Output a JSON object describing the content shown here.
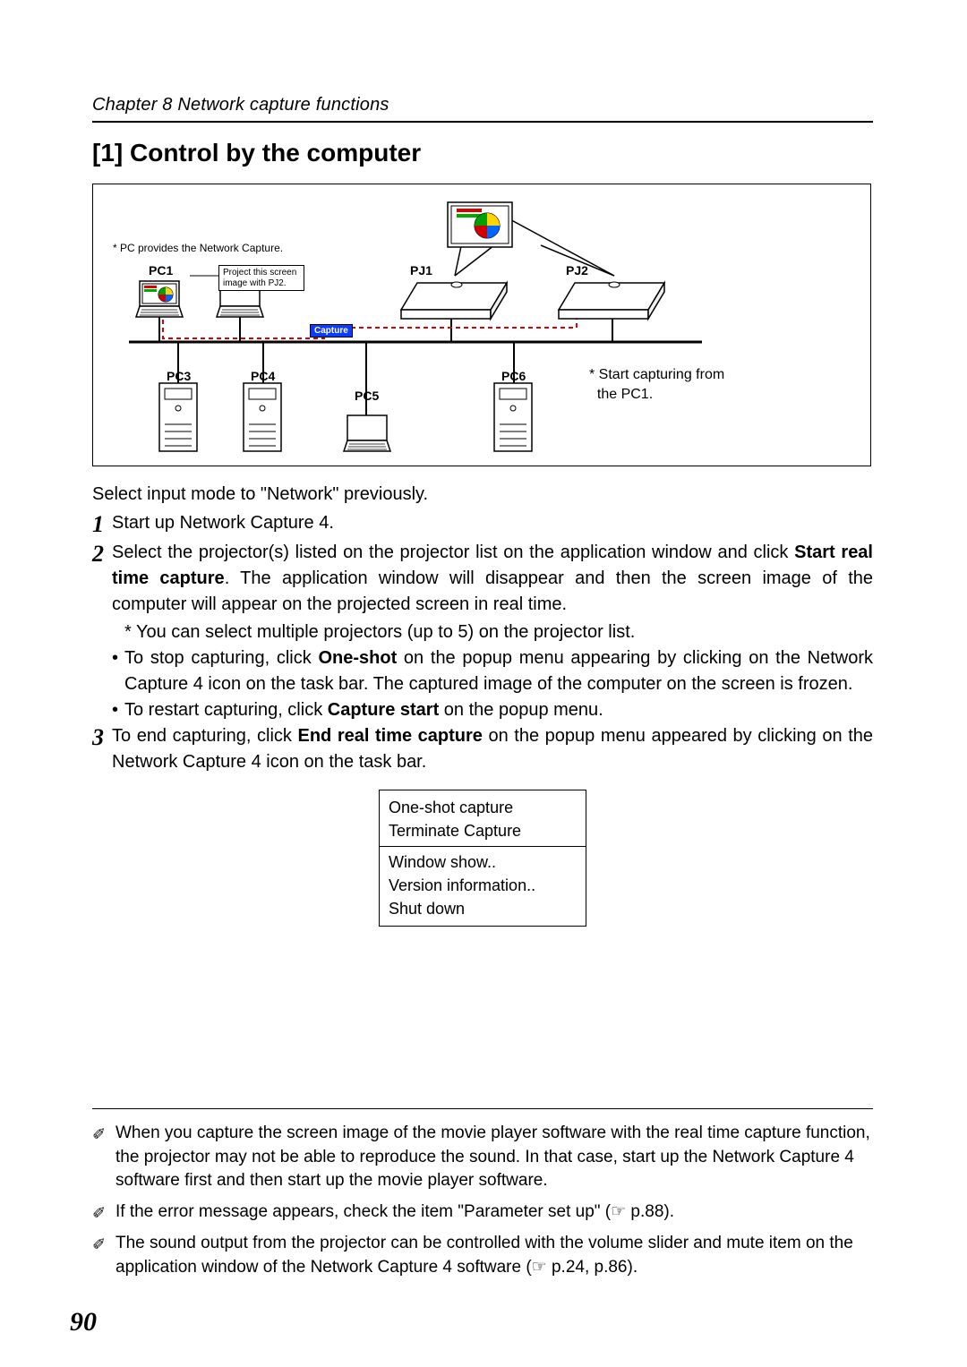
{
  "header": {
    "chapter": "Chapter 8 Network capture functions"
  },
  "title": "[1] Control by the computer",
  "diagram": {
    "pc_note": "* PC provides the Network Capture.",
    "labels": {
      "pc1": "PC1",
      "pc2_note_l1": "Project this screen",
      "pc2_note_l2": "image with PJ2.",
      "pj1": "PJ1",
      "pj2": "PJ2",
      "pc3": "PC3",
      "pc4": "PC4",
      "pc5": "PC5",
      "pc6": "PC6",
      "capture": "Capture"
    },
    "side_note_l1": "* Start capturing from",
    "side_note_l2": "the PC1."
  },
  "intro": "Select input mode to \"Network\" previously.",
  "steps": {
    "s1": "Start up Network Capture 4.",
    "s2a": "Select the projector(s) listed on the projector list on the application window and click ",
    "s2b": "Start real time capture",
    "s2c": ". The application window will disappear and then the screen image of the computer will appear on the projected screen in real time.",
    "s2_note": "* You can select multiple projectors (up to 5) on the projector list.",
    "s2_b1a": "To stop capturing, click ",
    "s2_b1b": "One-shot",
    "s2_b1c": " on the popup menu appearing by clicking on the Network Capture 4 icon on the task bar. The captured image of the computer on the screen is frozen.",
    "s2_b2a": "To restart capturing, click ",
    "s2_b2b": "Capture start",
    "s2_b2c": " on the popup menu.",
    "s3a": "To end capturing, click ",
    "s3b": "End real time capture",
    "s3c": " on the popup menu appeared by clicking on the Network Capture 4 icon on the task bar."
  },
  "popup": {
    "item1": "One-shot capture",
    "item2": "Terminate Capture",
    "item3": "Window show..",
    "item4": "Version information..",
    "item5": "Shut down"
  },
  "footnotes": {
    "f1": "When you capture the screen image of the movie player software with the real time capture function, the projector may not be able to reproduce the sound. In that case, start up the Network Capture 4 software first and then start up the movie player software.",
    "f2": "If the error message appears, check the item \"Parameter set up\"  (☞ p.88).",
    "f3": "The sound output from the projector can be controlled with the volume slider and mute item on the application window of the Network Capture 4 software (☞ p.24, p.86)."
  },
  "page_number": "90"
}
